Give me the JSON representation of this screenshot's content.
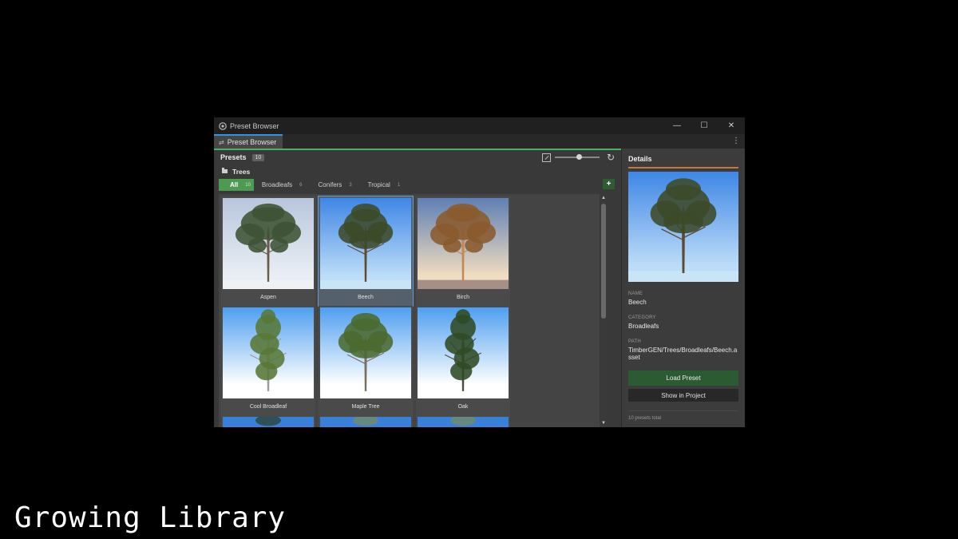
{
  "window": {
    "title": "Preset Browser",
    "minimize_glyph": "—",
    "maximize_glyph": "☐",
    "close_glyph": "✕"
  },
  "tab": {
    "label": "Preset Browser",
    "icon": "shuffle-icon"
  },
  "toolbar": {
    "presets_label": "Presets",
    "presets_count": "10",
    "zoom_level": 0.55
  },
  "folder": {
    "name": "Trees",
    "icon": "folder-icon"
  },
  "filters": [
    {
      "label": "All",
      "count": "10",
      "active": true
    },
    {
      "label": "Broadleafs",
      "count": "6",
      "active": false
    },
    {
      "label": "Conifers",
      "count": "3",
      "active": false
    },
    {
      "label": "Tropical",
      "count": "1",
      "active": false
    }
  ],
  "add_label": "+",
  "presets": [
    {
      "name": "Aspen",
      "sky_top": "#b8c6dc",
      "sky_bottom": "#e9eef4",
      "ground": "#eef2f5",
      "foliage": "#3e5234",
      "trunk": "#6a5a4a",
      "shape": "wide"
    },
    {
      "name": "Beech",
      "sky_top": "#3f86e6",
      "sky_bottom": "#bcdcf8",
      "ground": "#c9e3f7",
      "foliage": "#3c4a2a",
      "trunk": "#5e4a34",
      "shape": "round",
      "selected": true
    },
    {
      "name": "Birch",
      "sky_top": "#5f7fb4",
      "sky_bottom": "#f0dcc0",
      "ground": "#a58f87",
      "foliage": "#8a5a2e",
      "trunk": "#c08a56",
      "shape": "wide"
    },
    {
      "name": "Cool Broadleaf",
      "sky_top": "#4f9ef0",
      "sky_bottom": "#ffffff",
      "ground": "#ffffff",
      "foliage": "#587838",
      "trunk": "#9a9a90",
      "shape": "tall"
    },
    {
      "name": "Maple Tree",
      "sky_top": "#4f9ef0",
      "sky_bottom": "#ffffff",
      "ground": "#ffffff",
      "foliage": "#4a6a30",
      "trunk": "#7a6e60",
      "shape": "round"
    },
    {
      "name": "Oak",
      "sky_top": "#4f9ef0",
      "sky_bottom": "#ffffff",
      "ground": "#ffffff",
      "foliage": "#304a26",
      "trunk": "#4e4a42",
      "shape": "tall"
    },
    {
      "name": "",
      "sky_top": "#3a7fd8",
      "sky_bottom": "#3a7fd8",
      "ground": "#3a7fd8",
      "foliage": "#2c3a22",
      "trunk": "#444",
      "shape": "none"
    },
    {
      "name": "",
      "sky_top": "#3a7fd8",
      "sky_bottom": "#3a7fd8",
      "ground": "#3a7fd8",
      "foliage": "#7a8a60",
      "trunk": "#444",
      "shape": "none"
    },
    {
      "name": "",
      "sky_top": "#3a7fd8",
      "sky_bottom": "#3a7fd8",
      "ground": "#3a7fd8",
      "foliage": "#7a8a60",
      "trunk": "#444",
      "shape": "none"
    }
  ],
  "details": {
    "title": "Details",
    "accent": "#c07a44",
    "name_label": "NAME",
    "name": "Beech",
    "category_label": "CATEGORY",
    "category": "Broadleafs",
    "path_label": "PATH",
    "path": "TimberGEN/Trees/Broadleafs/Beech.asset",
    "load_button": "Load Preset",
    "show_button": "Show in Project",
    "total": "10 presets total"
  },
  "caption": "Growing Library"
}
